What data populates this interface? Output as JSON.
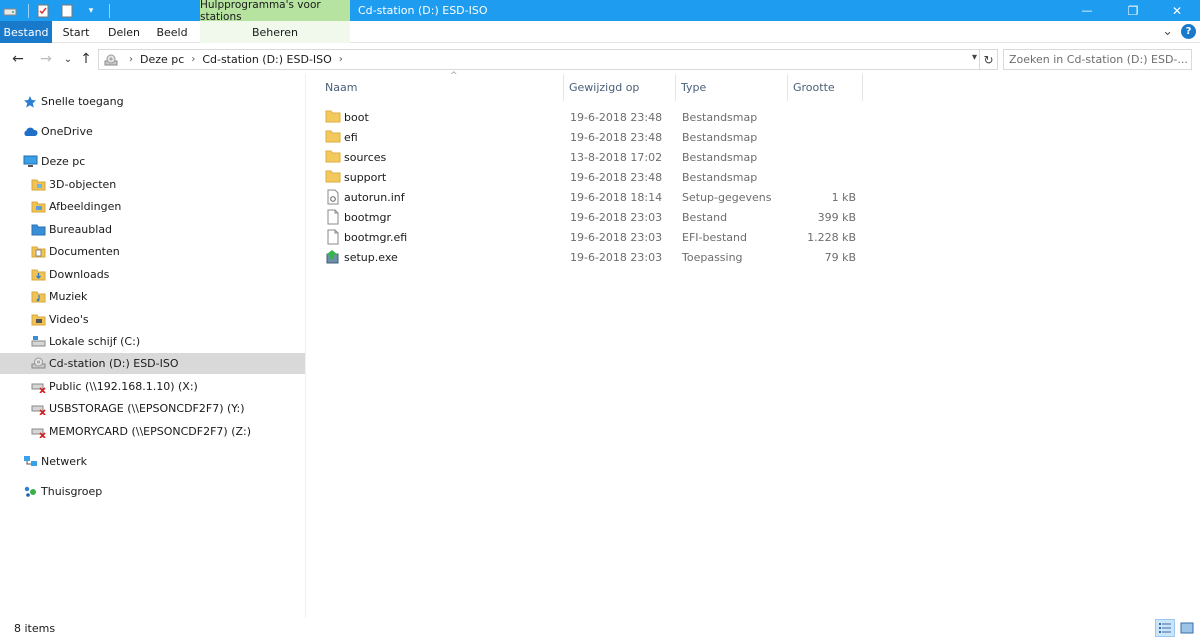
{
  "window": {
    "title": "Cd-station (D:) ESD-ISO",
    "context_tab_header": "Hulpprogramma's voor stations",
    "minimize": "—",
    "restore": "❐",
    "close": "✕"
  },
  "ribbon": {
    "tabs": [
      "Bestand",
      "Start",
      "Delen",
      "Beeld"
    ],
    "context_tab": "Beheren",
    "collapse_glyph": "⌄",
    "help_label": "?"
  },
  "address": {
    "back": "←",
    "forward": "→",
    "recent": "⌄",
    "up": "↑",
    "breadcrumbs": [
      "Deze pc",
      "Cd-station (D:) ESD-ISO"
    ],
    "refresh": "↻"
  },
  "search": {
    "placeholder": "Zoeken in Cd-station (D:) ESD-..."
  },
  "navigation": {
    "items": [
      {
        "label": "Snelle toegang",
        "icon": "star-icon"
      },
      {
        "label": "OneDrive",
        "icon": "cloud-icon"
      },
      {
        "label": "Deze pc",
        "icon": "computer-icon"
      },
      {
        "label": "3D-objecten",
        "icon": "folder-3d-icon"
      },
      {
        "label": "Afbeeldingen",
        "icon": "pictures-folder-icon"
      },
      {
        "label": "Bureaublad",
        "icon": "desktop-folder-icon"
      },
      {
        "label": "Documenten",
        "icon": "documents-folder-icon"
      },
      {
        "label": "Downloads",
        "icon": "downloads-folder-icon"
      },
      {
        "label": "Muziek",
        "icon": "music-folder-icon"
      },
      {
        "label": "Video's",
        "icon": "videos-folder-icon"
      },
      {
        "label": "Lokale schijf (C:)",
        "icon": "local-disk-icon"
      },
      {
        "label": "Cd-station (D:) ESD-ISO",
        "icon": "cd-drive-icon"
      },
      {
        "label": "Public (\\\\192.168.1.10) (X:)",
        "icon": "network-drive-disconnected-icon"
      },
      {
        "label": "USBSTORAGE (\\\\EPSONCDF2F7) (Y:)",
        "icon": "network-drive-disconnected-icon"
      },
      {
        "label": "MEMORYCARD (\\\\EPSONCDF2F7) (Z:)",
        "icon": "network-drive-disconnected-icon"
      },
      {
        "label": "Netwerk",
        "icon": "network-icon"
      },
      {
        "label": "Thuisgroep",
        "icon": "homegroup-icon"
      }
    ]
  },
  "file_list": {
    "columns": [
      "Naam",
      "Gewijzigd op",
      "Type",
      "Grootte"
    ],
    "sort_glyph": "^",
    "rows": [
      {
        "name": "boot",
        "date": "19-6-2018 23:48",
        "type": "Bestandsmap",
        "size": "",
        "icon": "folder-icon"
      },
      {
        "name": "efi",
        "date": "19-6-2018 23:48",
        "type": "Bestandsmap",
        "size": "",
        "icon": "folder-icon"
      },
      {
        "name": "sources",
        "date": "13-8-2018 17:02",
        "type": "Bestandsmap",
        "size": "",
        "icon": "folder-icon"
      },
      {
        "name": "support",
        "date": "19-6-2018 23:48",
        "type": "Bestandsmap",
        "size": "",
        "icon": "folder-icon"
      },
      {
        "name": "autorun.inf",
        "date": "19-6-2018 18:14",
        "type": "Setup-gegevens",
        "size": "1 kB",
        "icon": "settings-file-icon"
      },
      {
        "name": "bootmgr",
        "date": "19-6-2018 23:03",
        "type": "Bestand",
        "size": "399 kB",
        "icon": "file-icon"
      },
      {
        "name": "bootmgr.efi",
        "date": "19-6-2018 23:03",
        "type": "EFI-bestand",
        "size": "1.228 kB",
        "icon": "file-icon"
      },
      {
        "name": "setup.exe",
        "date": "19-6-2018 23:03",
        "type": "Toepassing",
        "size": "79 kB",
        "icon": "setup-exe-icon"
      }
    ]
  },
  "status": {
    "item_count": "8 items"
  },
  "colors": {
    "titlebar": "#1e9cf0",
    "file_tab": "#1979ca",
    "context_tab": "#b6e3a0",
    "selection": "#d9d9d9"
  }
}
